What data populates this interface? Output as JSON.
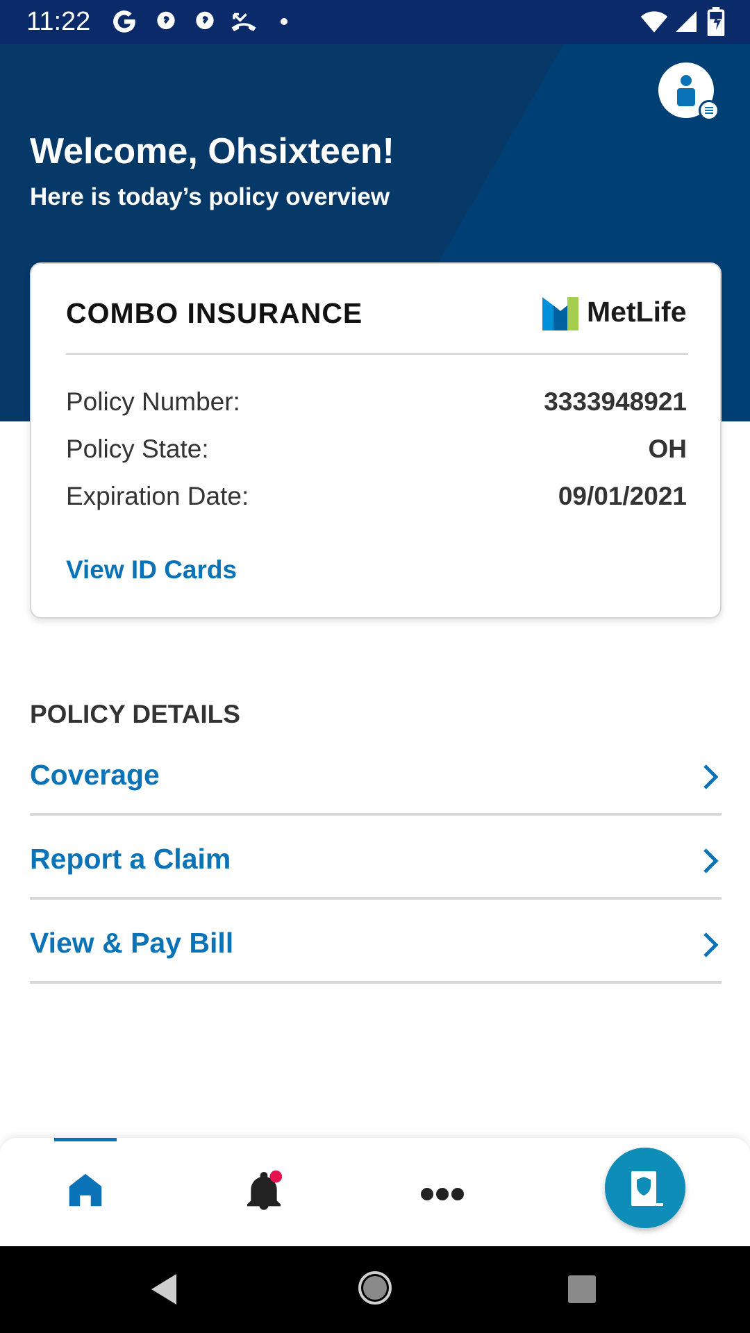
{
  "status_bar": {
    "time": "11:22",
    "icons": [
      "google-icon",
      "app-icon",
      "app-icon",
      "missed-call-icon",
      "dot-icon",
      "wifi-icon",
      "cell-signal-icon",
      "battery-icon"
    ]
  },
  "header": {
    "welcome": "Welcome, Ohsixteen!",
    "subtitle": "Here is today’s policy overview"
  },
  "policy_card": {
    "title": "COMBO INSURANCE",
    "brand": "MetLife",
    "rows": [
      {
        "label": "Policy Number:",
        "value": "3333948921"
      },
      {
        "label": "Policy State:",
        "value": "OH"
      },
      {
        "label": "Expiration Date:",
        "value": "09/01/2021"
      }
    ],
    "link": "View ID Cards"
  },
  "policy_details": {
    "title": "POLICY DETAILS",
    "items": [
      {
        "label": "Coverage"
      },
      {
        "label": "Report a Claim"
      },
      {
        "label": "View & Pay Bill"
      }
    ]
  },
  "bottom_nav": {
    "items": [
      "home-icon",
      "bell-icon",
      "more-icon"
    ],
    "fab": "policy-shield-icon"
  },
  "colors": {
    "header_bg": "#003f74",
    "status_bar_bg": "#0a2a6a",
    "link_blue": "#0a73b8",
    "fab_teal": "#0d8db8",
    "notification_dot": "#e4104f"
  }
}
